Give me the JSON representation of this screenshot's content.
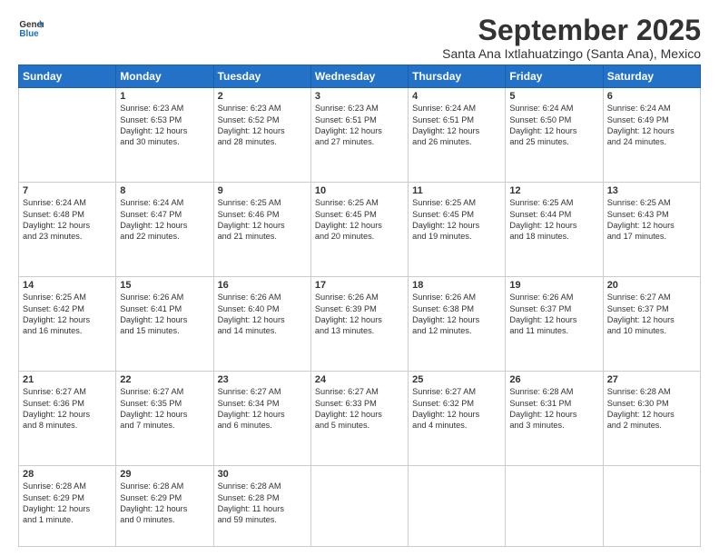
{
  "logo": {
    "line1": "General",
    "line2": "Blue"
  },
  "title": "September 2025",
  "subtitle": "Santa Ana Ixtlahuatzingo (Santa Ana), Mexico",
  "headers": [
    "Sunday",
    "Monday",
    "Tuesday",
    "Wednesday",
    "Thursday",
    "Friday",
    "Saturday"
  ],
  "weeks": [
    [
      {
        "day": "",
        "info": ""
      },
      {
        "day": "1",
        "info": "Sunrise: 6:23 AM\nSunset: 6:53 PM\nDaylight: 12 hours\nand 30 minutes."
      },
      {
        "day": "2",
        "info": "Sunrise: 6:23 AM\nSunset: 6:52 PM\nDaylight: 12 hours\nand 28 minutes."
      },
      {
        "day": "3",
        "info": "Sunrise: 6:23 AM\nSunset: 6:51 PM\nDaylight: 12 hours\nand 27 minutes."
      },
      {
        "day": "4",
        "info": "Sunrise: 6:24 AM\nSunset: 6:51 PM\nDaylight: 12 hours\nand 26 minutes."
      },
      {
        "day": "5",
        "info": "Sunrise: 6:24 AM\nSunset: 6:50 PM\nDaylight: 12 hours\nand 25 minutes."
      },
      {
        "day": "6",
        "info": "Sunrise: 6:24 AM\nSunset: 6:49 PM\nDaylight: 12 hours\nand 24 minutes."
      }
    ],
    [
      {
        "day": "7",
        "info": "Sunrise: 6:24 AM\nSunset: 6:48 PM\nDaylight: 12 hours\nand 23 minutes."
      },
      {
        "day": "8",
        "info": "Sunrise: 6:24 AM\nSunset: 6:47 PM\nDaylight: 12 hours\nand 22 minutes."
      },
      {
        "day": "9",
        "info": "Sunrise: 6:25 AM\nSunset: 6:46 PM\nDaylight: 12 hours\nand 21 minutes."
      },
      {
        "day": "10",
        "info": "Sunrise: 6:25 AM\nSunset: 6:45 PM\nDaylight: 12 hours\nand 20 minutes."
      },
      {
        "day": "11",
        "info": "Sunrise: 6:25 AM\nSunset: 6:45 PM\nDaylight: 12 hours\nand 19 minutes."
      },
      {
        "day": "12",
        "info": "Sunrise: 6:25 AM\nSunset: 6:44 PM\nDaylight: 12 hours\nand 18 minutes."
      },
      {
        "day": "13",
        "info": "Sunrise: 6:25 AM\nSunset: 6:43 PM\nDaylight: 12 hours\nand 17 minutes."
      }
    ],
    [
      {
        "day": "14",
        "info": "Sunrise: 6:25 AM\nSunset: 6:42 PM\nDaylight: 12 hours\nand 16 minutes."
      },
      {
        "day": "15",
        "info": "Sunrise: 6:26 AM\nSunset: 6:41 PM\nDaylight: 12 hours\nand 15 minutes."
      },
      {
        "day": "16",
        "info": "Sunrise: 6:26 AM\nSunset: 6:40 PM\nDaylight: 12 hours\nand 14 minutes."
      },
      {
        "day": "17",
        "info": "Sunrise: 6:26 AM\nSunset: 6:39 PM\nDaylight: 12 hours\nand 13 minutes."
      },
      {
        "day": "18",
        "info": "Sunrise: 6:26 AM\nSunset: 6:38 PM\nDaylight: 12 hours\nand 12 minutes."
      },
      {
        "day": "19",
        "info": "Sunrise: 6:26 AM\nSunset: 6:37 PM\nDaylight: 12 hours\nand 11 minutes."
      },
      {
        "day": "20",
        "info": "Sunrise: 6:27 AM\nSunset: 6:37 PM\nDaylight: 12 hours\nand 10 minutes."
      }
    ],
    [
      {
        "day": "21",
        "info": "Sunrise: 6:27 AM\nSunset: 6:36 PM\nDaylight: 12 hours\nand 8 minutes."
      },
      {
        "day": "22",
        "info": "Sunrise: 6:27 AM\nSunset: 6:35 PM\nDaylight: 12 hours\nand 7 minutes."
      },
      {
        "day": "23",
        "info": "Sunrise: 6:27 AM\nSunset: 6:34 PM\nDaylight: 12 hours\nand 6 minutes."
      },
      {
        "day": "24",
        "info": "Sunrise: 6:27 AM\nSunset: 6:33 PM\nDaylight: 12 hours\nand 5 minutes."
      },
      {
        "day": "25",
        "info": "Sunrise: 6:27 AM\nSunset: 6:32 PM\nDaylight: 12 hours\nand 4 minutes."
      },
      {
        "day": "26",
        "info": "Sunrise: 6:28 AM\nSunset: 6:31 PM\nDaylight: 12 hours\nand 3 minutes."
      },
      {
        "day": "27",
        "info": "Sunrise: 6:28 AM\nSunset: 6:30 PM\nDaylight: 12 hours\nand 2 minutes."
      }
    ],
    [
      {
        "day": "28",
        "info": "Sunrise: 6:28 AM\nSunset: 6:29 PM\nDaylight: 12 hours\nand 1 minute."
      },
      {
        "day": "29",
        "info": "Sunrise: 6:28 AM\nSunset: 6:29 PM\nDaylight: 12 hours\nand 0 minutes."
      },
      {
        "day": "30",
        "info": "Sunrise: 6:28 AM\nSunset: 6:28 PM\nDaylight: 11 hours\nand 59 minutes."
      },
      {
        "day": "",
        "info": ""
      },
      {
        "day": "",
        "info": ""
      },
      {
        "day": "",
        "info": ""
      },
      {
        "day": "",
        "info": ""
      }
    ]
  ]
}
